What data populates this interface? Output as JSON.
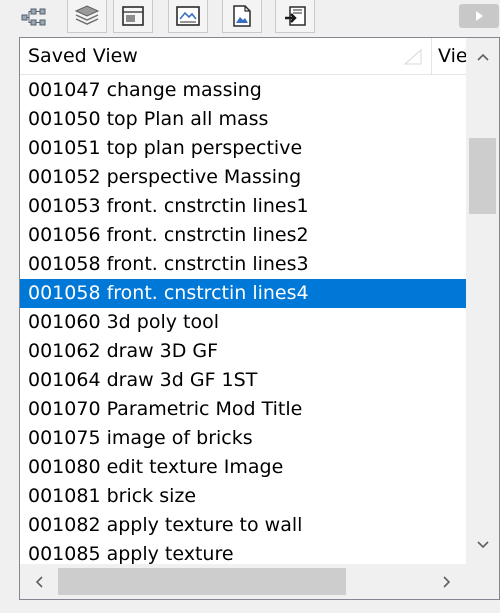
{
  "toolbar": {
    "buttons": [
      {
        "name": "hierarchy-view-icon"
      },
      {
        "name": "layers-icon"
      },
      {
        "name": "layout-view-icon"
      },
      {
        "name": "elevation-view-icon"
      },
      {
        "name": "document-view-icon"
      },
      {
        "name": "publish-export-icon"
      }
    ],
    "right_button_icon": "play-right-icon"
  },
  "list": {
    "columns": [
      "Saved View",
      "View"
    ],
    "rows": [
      "001047 change massing",
      "001050 top Plan all mass",
      "001051 top plan perspective",
      "001052 perspective Massing",
      "001053 front. cnstrctin lines1",
      "001056 front. cnstrctin lines2",
      "001058 front. cnstrctin lines3",
      "001058 front. cnstrctin lines4",
      "001060 3d poly tool",
      "001062 draw 3D GF",
      "001064 draw 3d GF 1ST",
      "001070 Parametric Mod Title",
      "001075 image of bricks",
      "001080 edit texture Image",
      "001081 brick size",
      "001082 apply texture to wall",
      "001085 apply texture"
    ],
    "selected_index": 7
  },
  "colors": {
    "selection": "#0078d7",
    "selection_text": "#ffffff",
    "scroll_thumb": "#cdcdcd",
    "panel_border": "#828790"
  }
}
